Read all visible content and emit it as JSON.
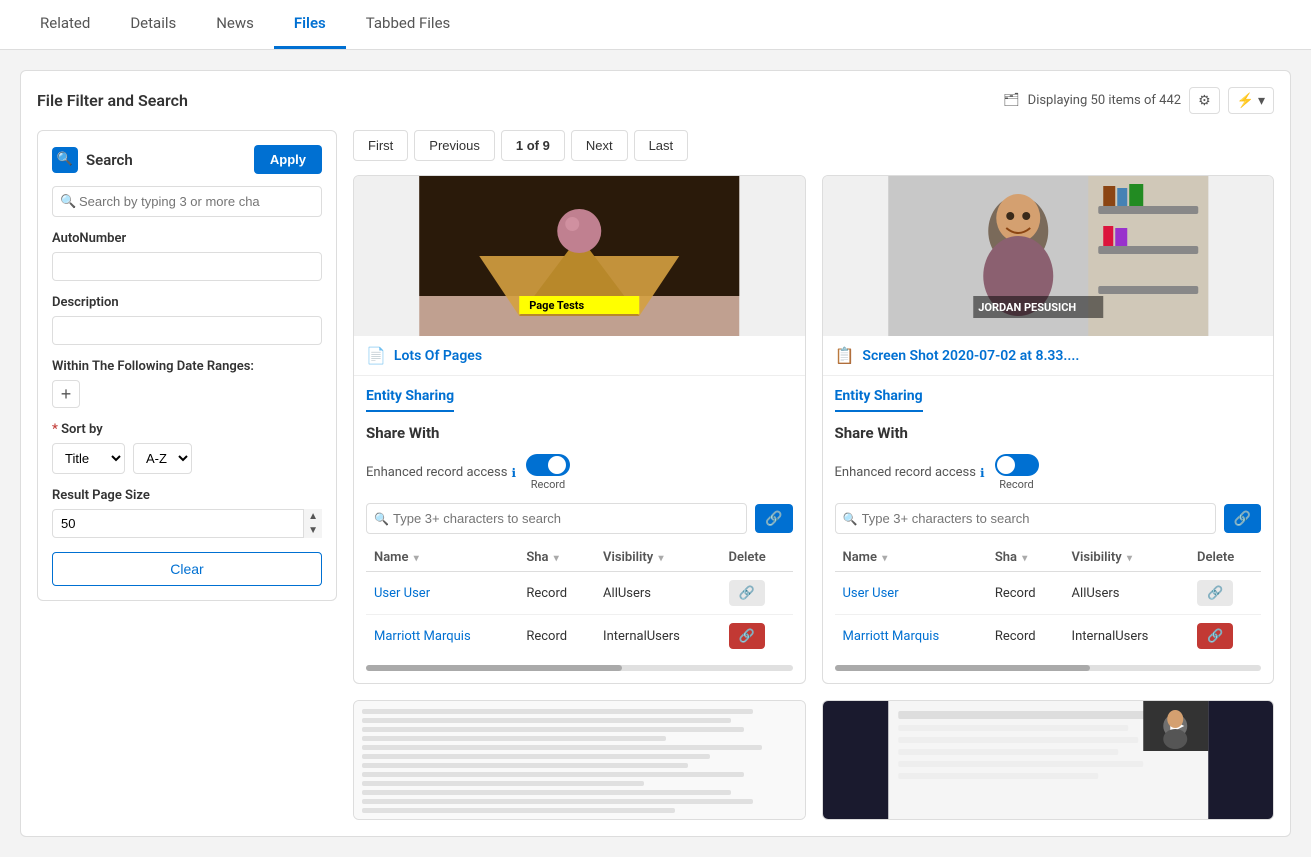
{
  "nav": {
    "tabs": [
      {
        "id": "related",
        "label": "Related",
        "active": false
      },
      {
        "id": "details",
        "label": "Details",
        "active": false
      },
      {
        "id": "news",
        "label": "News",
        "active": false
      },
      {
        "id": "files",
        "label": "Files",
        "active": true
      },
      {
        "id": "tabbed-files",
        "label": "Tabbed Files",
        "active": false
      }
    ]
  },
  "header": {
    "title": "File Filter and Search",
    "displaying": "Displaying 50 items of 442"
  },
  "pagination": {
    "first": "First",
    "previous": "Previous",
    "current": "1 of 9",
    "next": "Next",
    "last": "Last"
  },
  "sidebar": {
    "search_title": "Search",
    "apply_label": "Apply",
    "search_placeholder": "Search by typing 3 or more cha",
    "autonumber_label": "AutoNumber",
    "description_label": "Description",
    "date_range_label": "Within The Following Date Ranges:",
    "sort_label": "Sort by",
    "sort_options": [
      "Title",
      "A-Z"
    ],
    "sort_selected_1": "Title",
    "sort_selected_2": "A-Z",
    "page_size_label": "Result Page Size",
    "page_size_value": "50",
    "clear_label": "Clear"
  },
  "cards": [
    {
      "id": "card1",
      "title": "Lots Of Pages",
      "icon": "📄",
      "entity_section": "Entity Sharing",
      "share_with_title": "Share With",
      "enhanced_label": "Enhanced record access",
      "toggle_state": "right",
      "toggle_sub": "Record",
      "search_placeholder": "Type 3+ characters to search",
      "table_headers": [
        "Name",
        "Sha",
        "Visibility",
        "Delete"
      ],
      "table_rows": [
        {
          "name": "User User",
          "share": "Record",
          "visibility": "AllUsers",
          "delete_style": "gray"
        },
        {
          "name": "Marriott Marquis",
          "share": "Record",
          "visibility": "InternalUsers",
          "delete_style": "red"
        }
      ]
    },
    {
      "id": "card2",
      "title": "Screen Shot 2020-07-02 at 8.33....",
      "icon": "📋",
      "entity_section": "Entity Sharing",
      "share_with_title": "Share With",
      "enhanced_label": "Enhanced record access",
      "toggle_state": "left",
      "toggle_sub": "Record",
      "search_placeholder": "Type 3+ characters to search",
      "table_headers": [
        "Name",
        "Sha",
        "Visibility",
        "Delete"
      ],
      "table_rows": [
        {
          "name": "User User",
          "share": "Record",
          "visibility": "AllUsers",
          "delete_style": "gray"
        },
        {
          "name": "Marriott Marquis",
          "share": "Record",
          "visibility": "InternalUsers",
          "delete_style": "red"
        }
      ]
    }
  ],
  "icons": {
    "search": "🔍",
    "layers": "🗂",
    "gear": "⚙",
    "lightning": "⚡",
    "info": "ℹ",
    "link": "🔗",
    "plus": "+",
    "chevron_down": "▾",
    "chevron_up": "▴"
  }
}
